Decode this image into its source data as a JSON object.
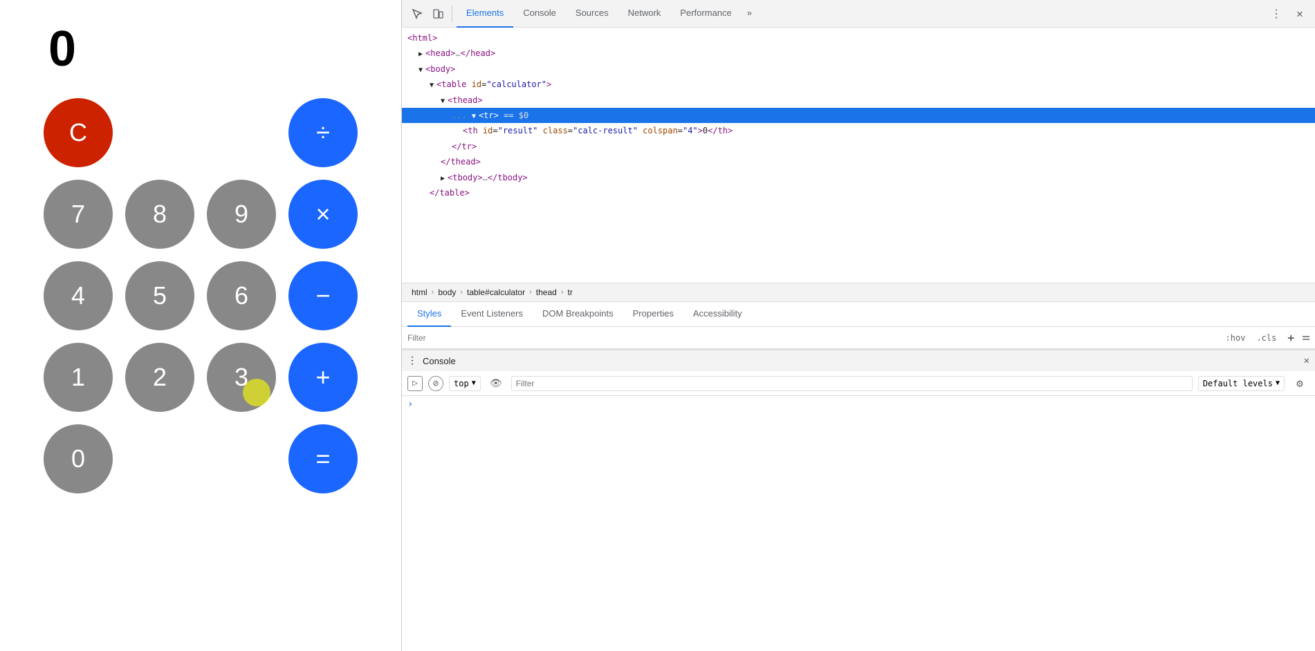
{
  "calculator": {
    "display": "0",
    "buttons": [
      {
        "label": "C",
        "class": "btn-red",
        "col": 1,
        "name": "clear-button"
      },
      {
        "label": "÷",
        "class": "btn-blue",
        "col": 4,
        "name": "divide-button"
      },
      {
        "label": "7",
        "class": "btn-gray",
        "col": 1,
        "name": "seven-button"
      },
      {
        "label": "8",
        "class": "btn-gray",
        "col": 2,
        "name": "eight-button"
      },
      {
        "label": "9",
        "class": "btn-gray",
        "col": 3,
        "name": "nine-button"
      },
      {
        "label": "×",
        "class": "btn-blue",
        "col": 4,
        "name": "multiply-button"
      },
      {
        "label": "4",
        "class": "btn-gray",
        "col": 1,
        "name": "four-button"
      },
      {
        "label": "5",
        "class": "btn-gray",
        "col": 2,
        "name": "five-button"
      },
      {
        "label": "6",
        "class": "btn-gray",
        "col": 3,
        "name": "six-button"
      },
      {
        "label": "−",
        "class": "btn-blue",
        "col": 4,
        "name": "minus-button"
      },
      {
        "label": "1",
        "class": "btn-gray",
        "col": 1,
        "name": "one-button"
      },
      {
        "label": "2",
        "class": "btn-gray",
        "col": 2,
        "name": "two-button"
      },
      {
        "label": "3",
        "class": "btn-gray",
        "col": 3,
        "name": "three-button"
      },
      {
        "label": "+",
        "class": "btn-blue",
        "col": 4,
        "name": "plus-button"
      },
      {
        "label": "0",
        "class": "btn-gray",
        "col": 1,
        "name": "zero-button"
      },
      {
        "label": "=",
        "class": "btn-blue",
        "col": 4,
        "name": "equals-button"
      }
    ]
  },
  "devtools": {
    "tabs": [
      {
        "label": "Elements",
        "active": true
      },
      {
        "label": "Console",
        "active": false
      },
      {
        "label": "Sources",
        "active": false
      },
      {
        "label": "Network",
        "active": false
      },
      {
        "label": "Performance",
        "active": false
      }
    ],
    "elements": {
      "lines": [
        {
          "indent": 0,
          "html": "&lt;html&gt;"
        },
        {
          "indent": 1,
          "html": "&#9654; &lt;head&gt;…&lt;/head&gt;"
        },
        {
          "indent": 1,
          "html": "&#9660; &lt;body&gt;"
        },
        {
          "indent": 2,
          "html": "&#9660; &lt;table id=<span class='attr-value'>\"calculator\"</span>&gt;"
        },
        {
          "indent": 3,
          "html": "&#9660; &lt;thead&gt;"
        },
        {
          "indent": 4,
          "selected": true,
          "html": "&#9660; &lt;tr&gt; == <span class='dollar'>$0</span>"
        },
        {
          "indent": 5,
          "html": "&lt;th id=<span class='attr-value'>\"result\"</span> class=<span class='attr-value'>\"calc-result\"</span> colspan=<span class='attr-value'>\"4\"</span>&gt;0&lt;/th&gt;"
        },
        {
          "indent": 4,
          "html": "&lt;/tr&gt;"
        },
        {
          "indent": 3,
          "html": "&lt;/thead&gt;"
        },
        {
          "indent": 3,
          "html": "&#9654; &lt;tbody&gt;…&lt;/tbody&gt;"
        },
        {
          "indent": 2,
          "html": "&lt;/table&gt;"
        }
      ]
    },
    "breadcrumb": [
      "html",
      "body",
      "table#calculator",
      "thead",
      "tr"
    ],
    "subTabs": [
      {
        "label": "Styles",
        "active": true
      },
      {
        "label": "Event Listeners",
        "active": false
      },
      {
        "label": "DOM Breakpoints",
        "active": false
      },
      {
        "label": "Properties",
        "active": false
      },
      {
        "label": "Accessibility",
        "active": false
      }
    ],
    "filter": {
      "placeholder": "Filter",
      "hov_label": ":hov",
      "cls_label": ".cls",
      "add_label": "+"
    },
    "console": {
      "title": "Console",
      "toolbar": {
        "context": "top",
        "filter_placeholder": "Filter",
        "levels_label": "Default levels"
      }
    }
  }
}
